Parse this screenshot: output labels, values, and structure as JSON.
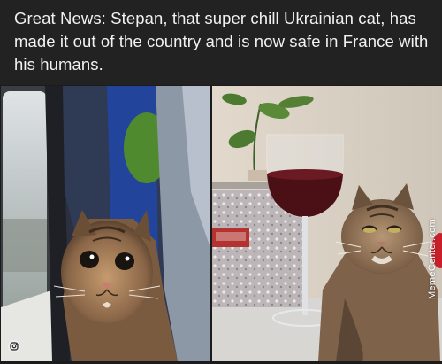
{
  "post": {
    "caption": "Great News: Stepan, that super chill Ukrainian cat, has made it out of the country and is now safe in France with his humans."
  },
  "images": {
    "left": {
      "subject": "cat-on-train"
    },
    "right": {
      "subject": "cat-with-wine-glass"
    }
  },
  "watermark": {
    "text": "MemeCenter.com"
  },
  "icons": {
    "bottom_left": "instagram-icon"
  },
  "colors": {
    "caption_bg": "#222222",
    "caption_text": "#f2f2f2"
  }
}
